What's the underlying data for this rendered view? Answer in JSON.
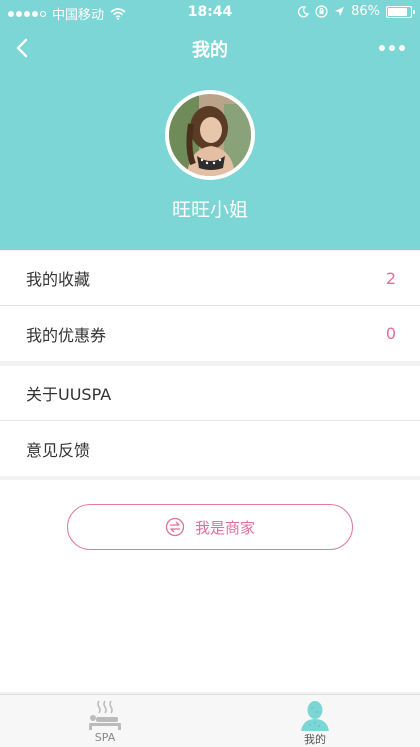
{
  "statusbar": {
    "carrier": "中国移动",
    "time": "18:44",
    "battery": "86%"
  },
  "nav": {
    "title": "我的"
  },
  "profile": {
    "username": "旺旺小姐"
  },
  "section1": {
    "rows": [
      {
        "label": "我的收藏",
        "value": "2"
      },
      {
        "label": "我的优惠券",
        "value": "0"
      }
    ]
  },
  "section2": {
    "rows": [
      {
        "label": "关于UUSPA"
      },
      {
        "label": "意见反馈"
      }
    ]
  },
  "merchant": {
    "label": "我是商家"
  },
  "tabbar": {
    "tabs": [
      {
        "label": "SPA",
        "icon": "spa-icon"
      },
      {
        "label": "我的",
        "icon": "profile-icon"
      }
    ]
  },
  "colors": {
    "header": "#7dd6d6",
    "accent": "#e0709a"
  }
}
